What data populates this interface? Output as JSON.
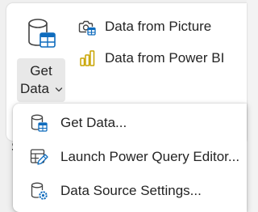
{
  "ribbon": {
    "get_data": {
      "line1": "Get",
      "line2": "Data",
      "icon": "database-table-icon"
    },
    "items": [
      {
        "label": "Data from Picture",
        "icon": "picture-data-icon"
      },
      {
        "label": "Data from Power BI",
        "icon": "power-bi-icon"
      }
    ],
    "partial_text": "S"
  },
  "menu": {
    "items": [
      {
        "label": "Get Data...",
        "icon": "database-table-icon"
      },
      {
        "label": "Launch Power Query Editor...",
        "icon": "table-edit-icon"
      },
      {
        "label": "Data Source Settings...",
        "icon": "database-settings-icon"
      }
    ]
  },
  "colors": {
    "accent_blue": "#0f6cbd",
    "power_bi_yellow": "#c8a400",
    "text": "#242424"
  }
}
